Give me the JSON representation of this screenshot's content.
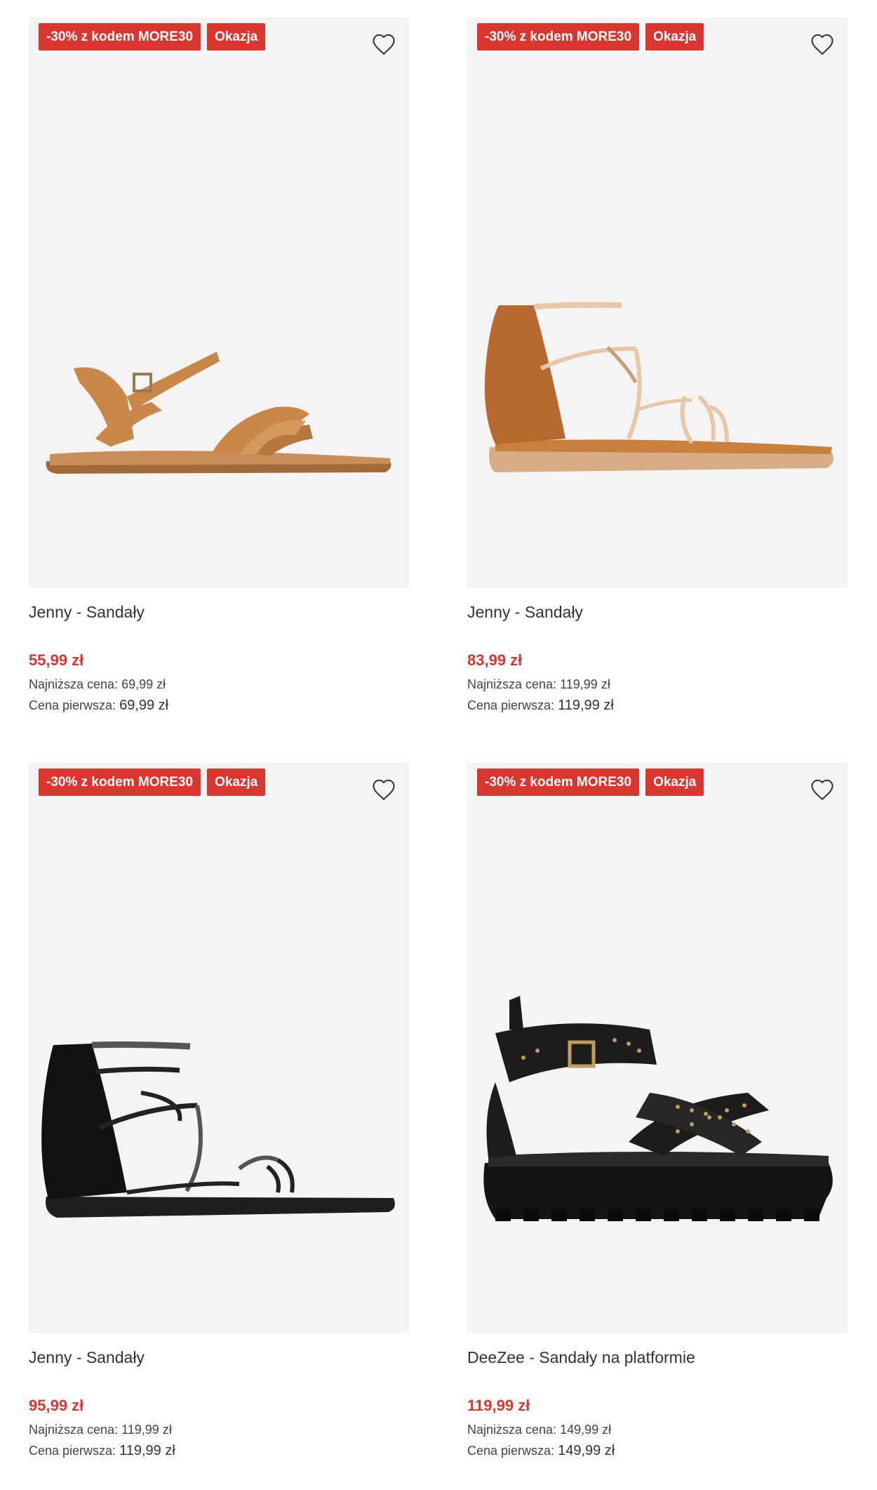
{
  "colors": {
    "badge_bg": "#d8362f",
    "price": "#d8362f",
    "image_bg": "#f4f4f4",
    "text": "#333333"
  },
  "labels": {
    "lowest_price": "Najniższa cena:",
    "first_price": "Cena pierwsza:"
  },
  "products": [
    {
      "promo_badge": "-30% z kodem MORE30",
      "deal_badge": "Okazja",
      "favorite_icon": "heart-outline-icon",
      "name": "Jenny - Sandały",
      "price": "55,99 zł",
      "lowest_price": "69,99 zł",
      "first_price": "69,99 zł"
    },
    {
      "promo_badge": "-30% z kodem MORE30",
      "deal_badge": "Okazja",
      "favorite_icon": "heart-outline-icon",
      "name": "Jenny - Sandały",
      "price": "83,99 zł",
      "lowest_price": "119,99 zł",
      "first_price": "119,99 zł"
    },
    {
      "promo_badge": "-30% z kodem MORE30",
      "deal_badge": "Okazja",
      "favorite_icon": "heart-outline-icon",
      "name": "Jenny - Sandały",
      "price": "95,99 zł",
      "lowest_price": "119,99 zł",
      "first_price": "119,99 zł"
    },
    {
      "promo_badge": "-30% z kodem MORE30",
      "deal_badge": "Okazja",
      "favorite_icon": "heart-outline-icon",
      "name": "DeeZee - Sandały na platformie",
      "price": "119,99 zł",
      "lowest_price": "149,99 zł",
      "first_price": "149,99 zł"
    }
  ]
}
